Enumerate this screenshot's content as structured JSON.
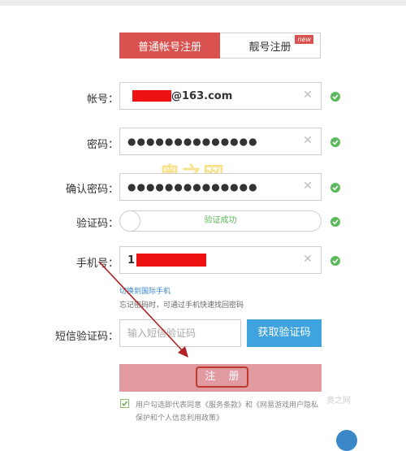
{
  "tabs": {
    "normal": "普通帐号注册",
    "pretty": "靓号注册",
    "badge": "new"
  },
  "form": {
    "account": {
      "label": "帐号：",
      "value_suffix": "@163.com"
    },
    "password": {
      "label": "密码：",
      "value": "●●●●●●●●●●●●●●"
    },
    "confirm": {
      "label": "确认密码：",
      "value": "●●●●●●●●●●●●●●"
    },
    "captcha": {
      "label": "验证码：",
      "status": "验证成功"
    },
    "phone": {
      "label": "手机号：",
      "value_prefix": "1"
    },
    "intl_link": "切换到国际手机",
    "hint": "忘记密码时，可通过手机快速找回密码",
    "sms": {
      "label": "短信验证码：",
      "placeholder": "输入短信验证码",
      "button": "获取验证码"
    },
    "register": "注 册",
    "agreement": "用户勾选即代表同意《服务条款》和《网易游戏用户隐私保护和个人信息利用政策》"
  },
  "watermarks": {
    "center": "奥之网",
    "corner": "奥之网"
  },
  "colors": {
    "primary": "#d9524f",
    "success": "#5cb85c",
    "blue": "#3ea3de",
    "register_bg": "#e09aa0"
  }
}
